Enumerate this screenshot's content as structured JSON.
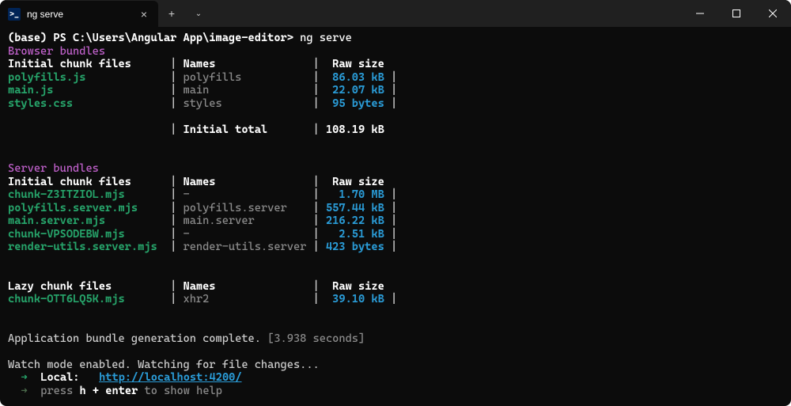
{
  "window": {
    "tab_title": "ng serve",
    "tab_icon_glyph": ">_"
  },
  "prompt": {
    "prefix": "(base) PS C:\\Users\\Angular App\\image-editor> ",
    "command": "ng serve"
  },
  "browser": {
    "heading": "Browser bundles",
    "header": {
      "col1": "Initial chunk files",
      "col2": "Names",
      "col3": "Raw size"
    },
    "rows": [
      {
        "file": "polyfills.js",
        "name": "polyfills",
        "size": "86.03 kB"
      },
      {
        "file": "main.js",
        "name": "main",
        "size": "22.07 kB"
      },
      {
        "file": "styles.css",
        "name": "styles",
        "size": "95 bytes"
      }
    ],
    "total_label": "Initial total",
    "total_size": "108.19 kB"
  },
  "server": {
    "heading": "Server bundles",
    "header": {
      "col1": "Initial chunk files",
      "col2": "Names",
      "col3": "Raw size"
    },
    "rows": [
      {
        "file": "chunk-Z3ITZIOL.mjs",
        "name": "-",
        "size": "1.70 MB"
      },
      {
        "file": "polyfills.server.mjs",
        "name": "polyfills.server",
        "size": "557.44 kB"
      },
      {
        "file": "main.server.mjs",
        "name": "main.server",
        "size": "216.22 kB"
      },
      {
        "file": "chunk-VPSODEBW.mjs",
        "name": "-",
        "size": "2.51 kB"
      },
      {
        "file": "render-utils.server.mjs",
        "name": "render-utils.server",
        "size": "423 bytes"
      }
    ],
    "lazy_header": {
      "col1": "Lazy chunk files",
      "col2": "Names",
      "col3": "Raw size"
    },
    "lazy_rows": [
      {
        "file": "chunk-OTT6LQ5K.mjs",
        "name": "xhr2",
        "size": "39.10 kB"
      }
    ]
  },
  "status": {
    "complete_prefix": "Application bundle generation complete. ",
    "complete_time": "[3.938 seconds]",
    "watch": "Watch mode enabled. Watching for file changes...",
    "local_label": "Local:",
    "local_url": "http://localhost:4200/",
    "help_prefix": "press ",
    "help_key": "h + enter",
    "help_suffix": " to show help"
  }
}
